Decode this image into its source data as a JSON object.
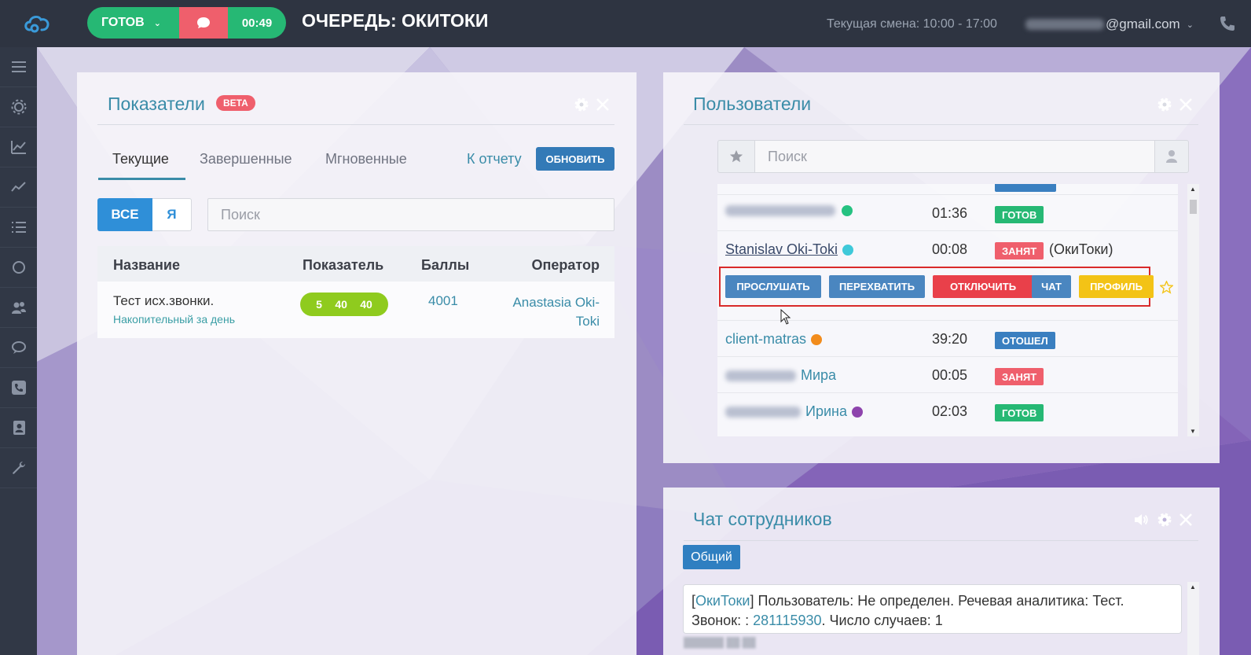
{
  "topbar": {
    "status_label": "ГОТОВ",
    "timer": "00:49",
    "queue_title": "ОЧЕРЕДЬ: ОКИТОКИ",
    "shift": "Текущая смена: 10:00 - 17:00",
    "email": "@gmail.com"
  },
  "colors": {
    "ready": "#26b874",
    "busy": "#ef5f6c",
    "away": "#3a7fc0",
    "profile": "#f3c316",
    "accent": "#3a8ca8",
    "topbar": "#2e3441"
  },
  "sidebar": {
    "icons": [
      "menu-icon",
      "settings-icon",
      "chart-icon",
      "trend-icon",
      "list-icon",
      "circle-icon",
      "users-icon",
      "chat-icon",
      "phone-icon",
      "contacts-icon",
      "wrench-icon"
    ]
  },
  "metrics_panel": {
    "title": "Показатели",
    "badge": "BETA",
    "tabs": [
      "Текущие",
      "Завершенные",
      "Мгновенные"
    ],
    "report_link": "К отчету",
    "refresh_button": "ОБНОВИТЬ",
    "filter_all": "ВСЕ",
    "filter_me": "Я",
    "search_placeholder": "Поиск",
    "columns": [
      "Название",
      "Показатель",
      "Баллы",
      "Оператор"
    ],
    "rows": [
      {
        "name": "Тест исх.звонки.",
        "subtitle": "Накопительный за день",
        "metric_values": [
          "5",
          "40",
          "40"
        ],
        "score": "4001",
        "operator": "Anastasia Oki-Toki"
      }
    ]
  },
  "users_panel": {
    "title": "Пользователи",
    "search_placeholder": "Поиск",
    "users": [
      {
        "name": "",
        "time": "01:36",
        "status": "ГОТОВ"
      },
      {
        "name": "Stanislav Oki-Toki",
        "time": "00:08",
        "status": "ЗАНЯТ",
        "extra": "(ОкиТоки)"
      },
      {
        "name": "client-matras",
        "time": "39:20",
        "status": "ОТОШЕЛ"
      },
      {
        "name": "Мира",
        "time": "00:05",
        "status": "ЗАНЯТ"
      },
      {
        "name": "Ирина",
        "time": "02:03",
        "status": "ГОТОВ"
      }
    ],
    "actions": [
      "ПРОСЛУШАТЬ",
      "ПЕРЕХВАТИТЬ",
      "ОТКЛЮЧИТЬ",
      "ЧАТ",
      "ПРОФИЛЬ"
    ]
  },
  "chat_panel": {
    "title": "Чат сотрудников",
    "tab": "Общий",
    "message": {
      "queue_link": "ОкиТоки",
      "text1": "Пользователь: Не определен. Речевая аналитика: Тест.",
      "text2_prefix": "Звонок: :",
      "call_link": "281115930",
      "text2_suffix": ". Число случаев: 1"
    }
  }
}
